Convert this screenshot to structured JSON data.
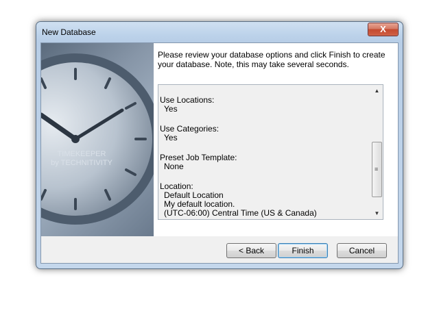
{
  "window": {
    "title": "New Database",
    "close_symbol": "X"
  },
  "side_image": {
    "brand_line1": "TIMEKEEPER",
    "brand_line2": "by TECHNITIVITY"
  },
  "intro_text": "Please review your database options and click Finish to create your database. Note, this may take several seconds.",
  "summary": [
    {
      "label": "Use Locations:",
      "values": [
        "Yes"
      ]
    },
    {
      "label": "Use Categories:",
      "values": [
        "Yes"
      ]
    },
    {
      "label": "Preset Job Template:",
      "values": [
        "None"
      ]
    },
    {
      "label": "Location:",
      "values": [
        "Default Location",
        "My default location.",
        "(UTC-06:00) Central Time (US & Canada)"
      ]
    }
  ],
  "buttons": {
    "back": "< Back",
    "finish": "Finish",
    "cancel": "Cancel"
  },
  "icons": {
    "scroll_up": "chevron-up-icon",
    "scroll_down": "chevron-down-icon",
    "close": "close-icon"
  },
  "colors": {
    "close_button": "#c44a30",
    "window_frame": "#b7cde6",
    "default_button_border": "#3c7fb1"
  }
}
